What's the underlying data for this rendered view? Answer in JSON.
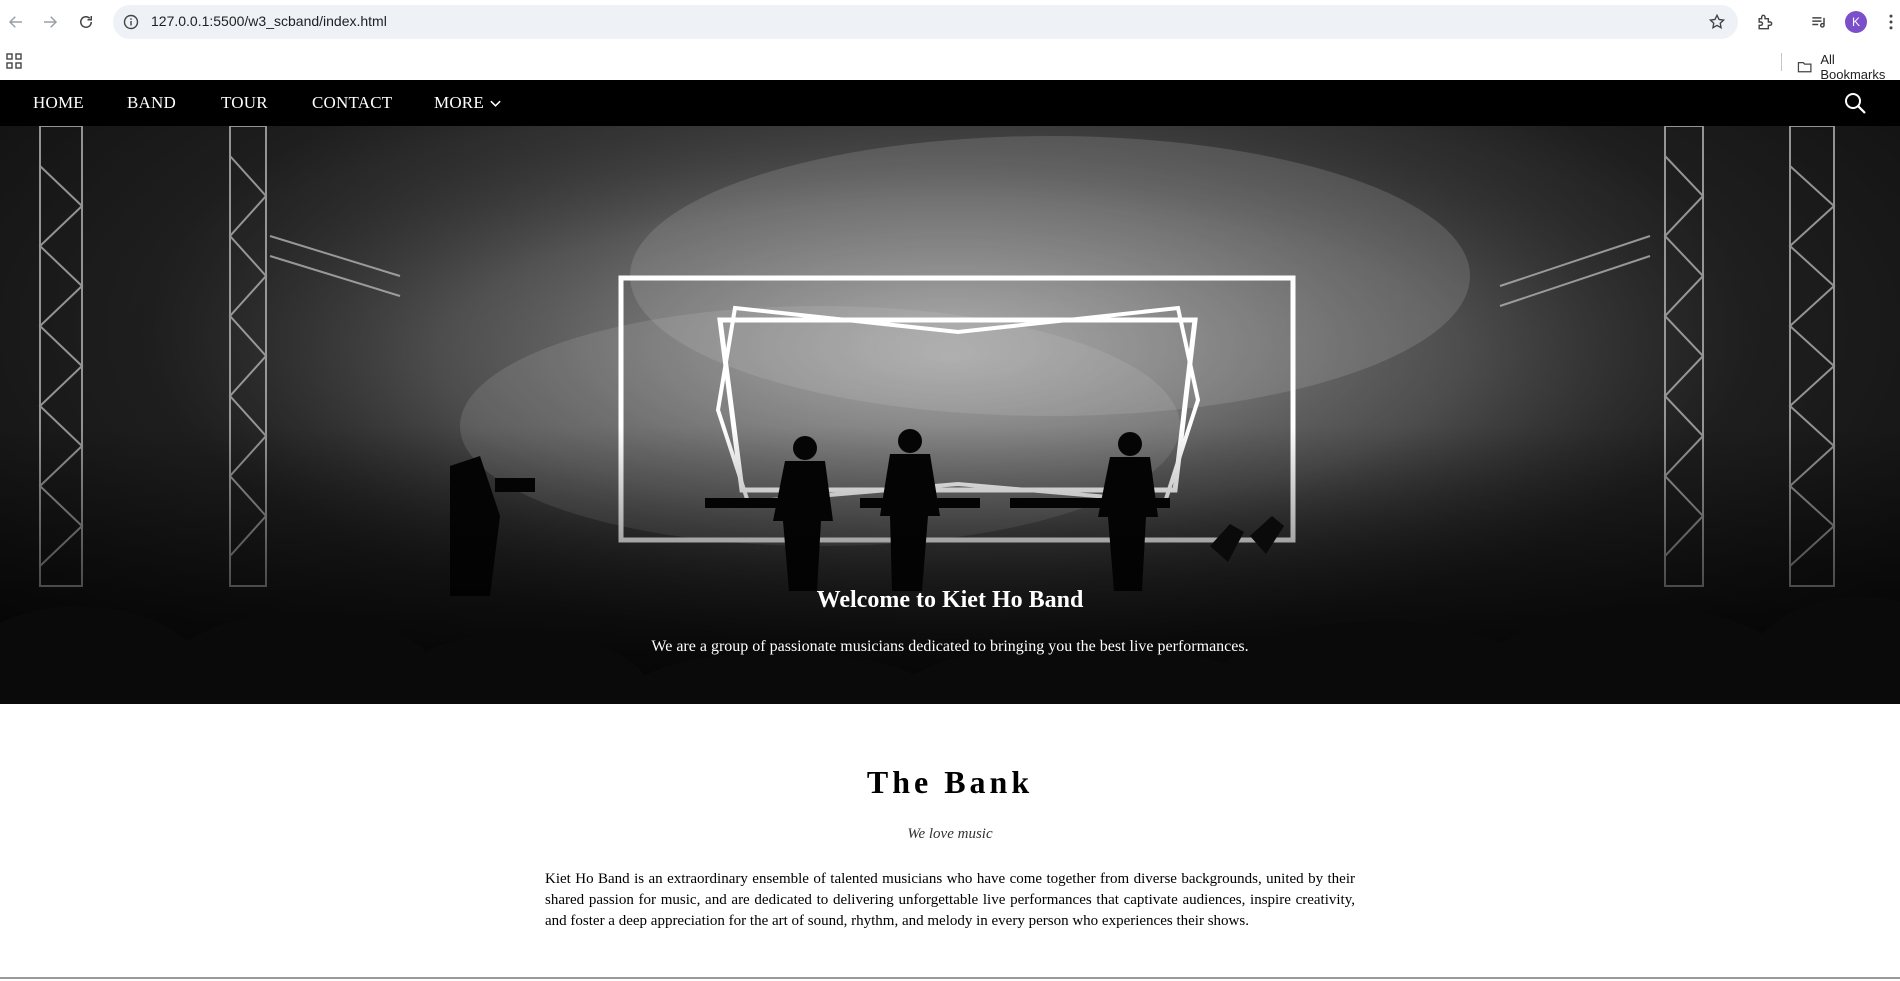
{
  "browser": {
    "url": "127.0.0.1:5500/w3_scband/index.html",
    "avatar_letter": "K",
    "all_bookmarks_label": "All Bookmarks",
    "icons": [
      "back-arrow-icon",
      "forward-arrow-icon",
      "reload-icon",
      "site-info-icon",
      "bookmark-star-icon",
      "extensions-icon",
      "media-queue-icon",
      "more-vert-icon",
      "apps-grid-icon",
      "folder-icon"
    ]
  },
  "nav": {
    "items": [
      {
        "label": "HOME"
      },
      {
        "label": "BAND"
      },
      {
        "label": "TOUR"
      },
      {
        "label": "CONTACT"
      },
      {
        "label": "MORE"
      }
    ],
    "icons": [
      "chevron-down-icon",
      "search-icon"
    ]
  },
  "hero": {
    "title": "Welcome to Kiet Ho Band",
    "subtitle": "We are a group of passionate musicians dedicated to bringing you the best live performances."
  },
  "band": {
    "title": "The Bank",
    "tagline": "We love music",
    "description": "Kiet Ho Band is an extraordinary ensemble of talented musicians who have come together from diverse backgrounds, united by their shared passion for music, and are dedicated to delivering unforgettable live performances that captivate audiences, inspire creativity, and foster a deep appreciation for the art of sound, rhythm, and melody in every person who experiences their shows."
  },
  "colors": {
    "nav_background": "#000000",
    "nav_text": "#ffffff",
    "omnibox_background": "#eef1f6",
    "avatar": "#7b4fc9"
  }
}
